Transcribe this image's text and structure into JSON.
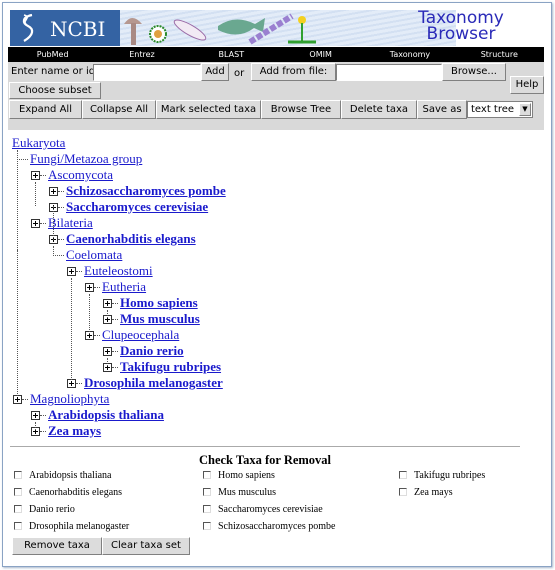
{
  "banner": {
    "logo_text": "NCBI",
    "title_line1": "Taxonomy",
    "title_line2": "Browser"
  },
  "nav": [
    "PubMed",
    "Entrez",
    "BLAST",
    "OMIM",
    "Taxonomy",
    "Structure"
  ],
  "form": {
    "name_label": "Enter name or id",
    "name_value": "",
    "add_label": "Add",
    "or_label": "or",
    "add_from_file_label": "Add from file:",
    "file_value": "",
    "browse_label": "Browse...",
    "help_label": "Help",
    "choose_subset_label": "Choose subset"
  },
  "toolbar": {
    "expand_all": "Expand All",
    "collapse_all": "Collapse All",
    "mark_selected": "Mark selected taxa",
    "browse_tree": "Browse Tree",
    "delete_taxa": "Delete taxa",
    "save_as": "Save as",
    "save_format": "text tree"
  },
  "tree": [
    {
      "label": "Eukaryota",
      "leaf": false
    },
    {
      "label": "Fungi/Metazoa group",
      "leaf": false
    },
    {
      "label": "Ascomycota",
      "leaf": false
    },
    {
      "label": "Schizosaccharomyces pombe",
      "leaf": true
    },
    {
      "label": "Saccharomyces cerevisiae",
      "leaf": true
    },
    {
      "label": "Bilateria",
      "leaf": false
    },
    {
      "label": "Caenorhabditis elegans",
      "leaf": true
    },
    {
      "label": "Coelomata",
      "leaf": false
    },
    {
      "label": "Euteleostomi",
      "leaf": false
    },
    {
      "label": "Eutheria",
      "leaf": false
    },
    {
      "label": "Homo sapiens",
      "leaf": true
    },
    {
      "label": "Mus musculus",
      "leaf": true
    },
    {
      "label": "Clupeocephala",
      "leaf": false
    },
    {
      "label": "Danio rerio",
      "leaf": true
    },
    {
      "label": "Takifugu rubripes",
      "leaf": true
    },
    {
      "label": "Drosophila melanogaster",
      "leaf": true
    },
    {
      "label": "Magnoliophyta",
      "leaf": false
    },
    {
      "label": "Arabidopsis thaliana",
      "leaf": true
    },
    {
      "label": "Zea mays",
      "leaf": true
    }
  ],
  "removal": {
    "title": "Check Taxa for Removal",
    "items": [
      {
        "label": "Arabidopsis thaliana",
        "checked": false
      },
      {
        "label": "Caenorhabditis elegans",
        "checked": false
      },
      {
        "label": "Danio rerio",
        "checked": false
      },
      {
        "label": "Drosophila melanogaster",
        "checked": false
      },
      {
        "label": "Homo sapiens",
        "checked": false
      },
      {
        "label": "Mus musculus",
        "checked": false
      },
      {
        "label": "Saccharomyces cerevisiae",
        "checked": false
      },
      {
        "label": "Schizosaccharomyces pombe",
        "checked": false
      },
      {
        "label": "Takifugu rubripes",
        "checked": false
      },
      {
        "label": "Zea mays",
        "checked": false
      }
    ],
    "remove_label": "Remove taxa",
    "clear_label": "Clear taxa set"
  }
}
